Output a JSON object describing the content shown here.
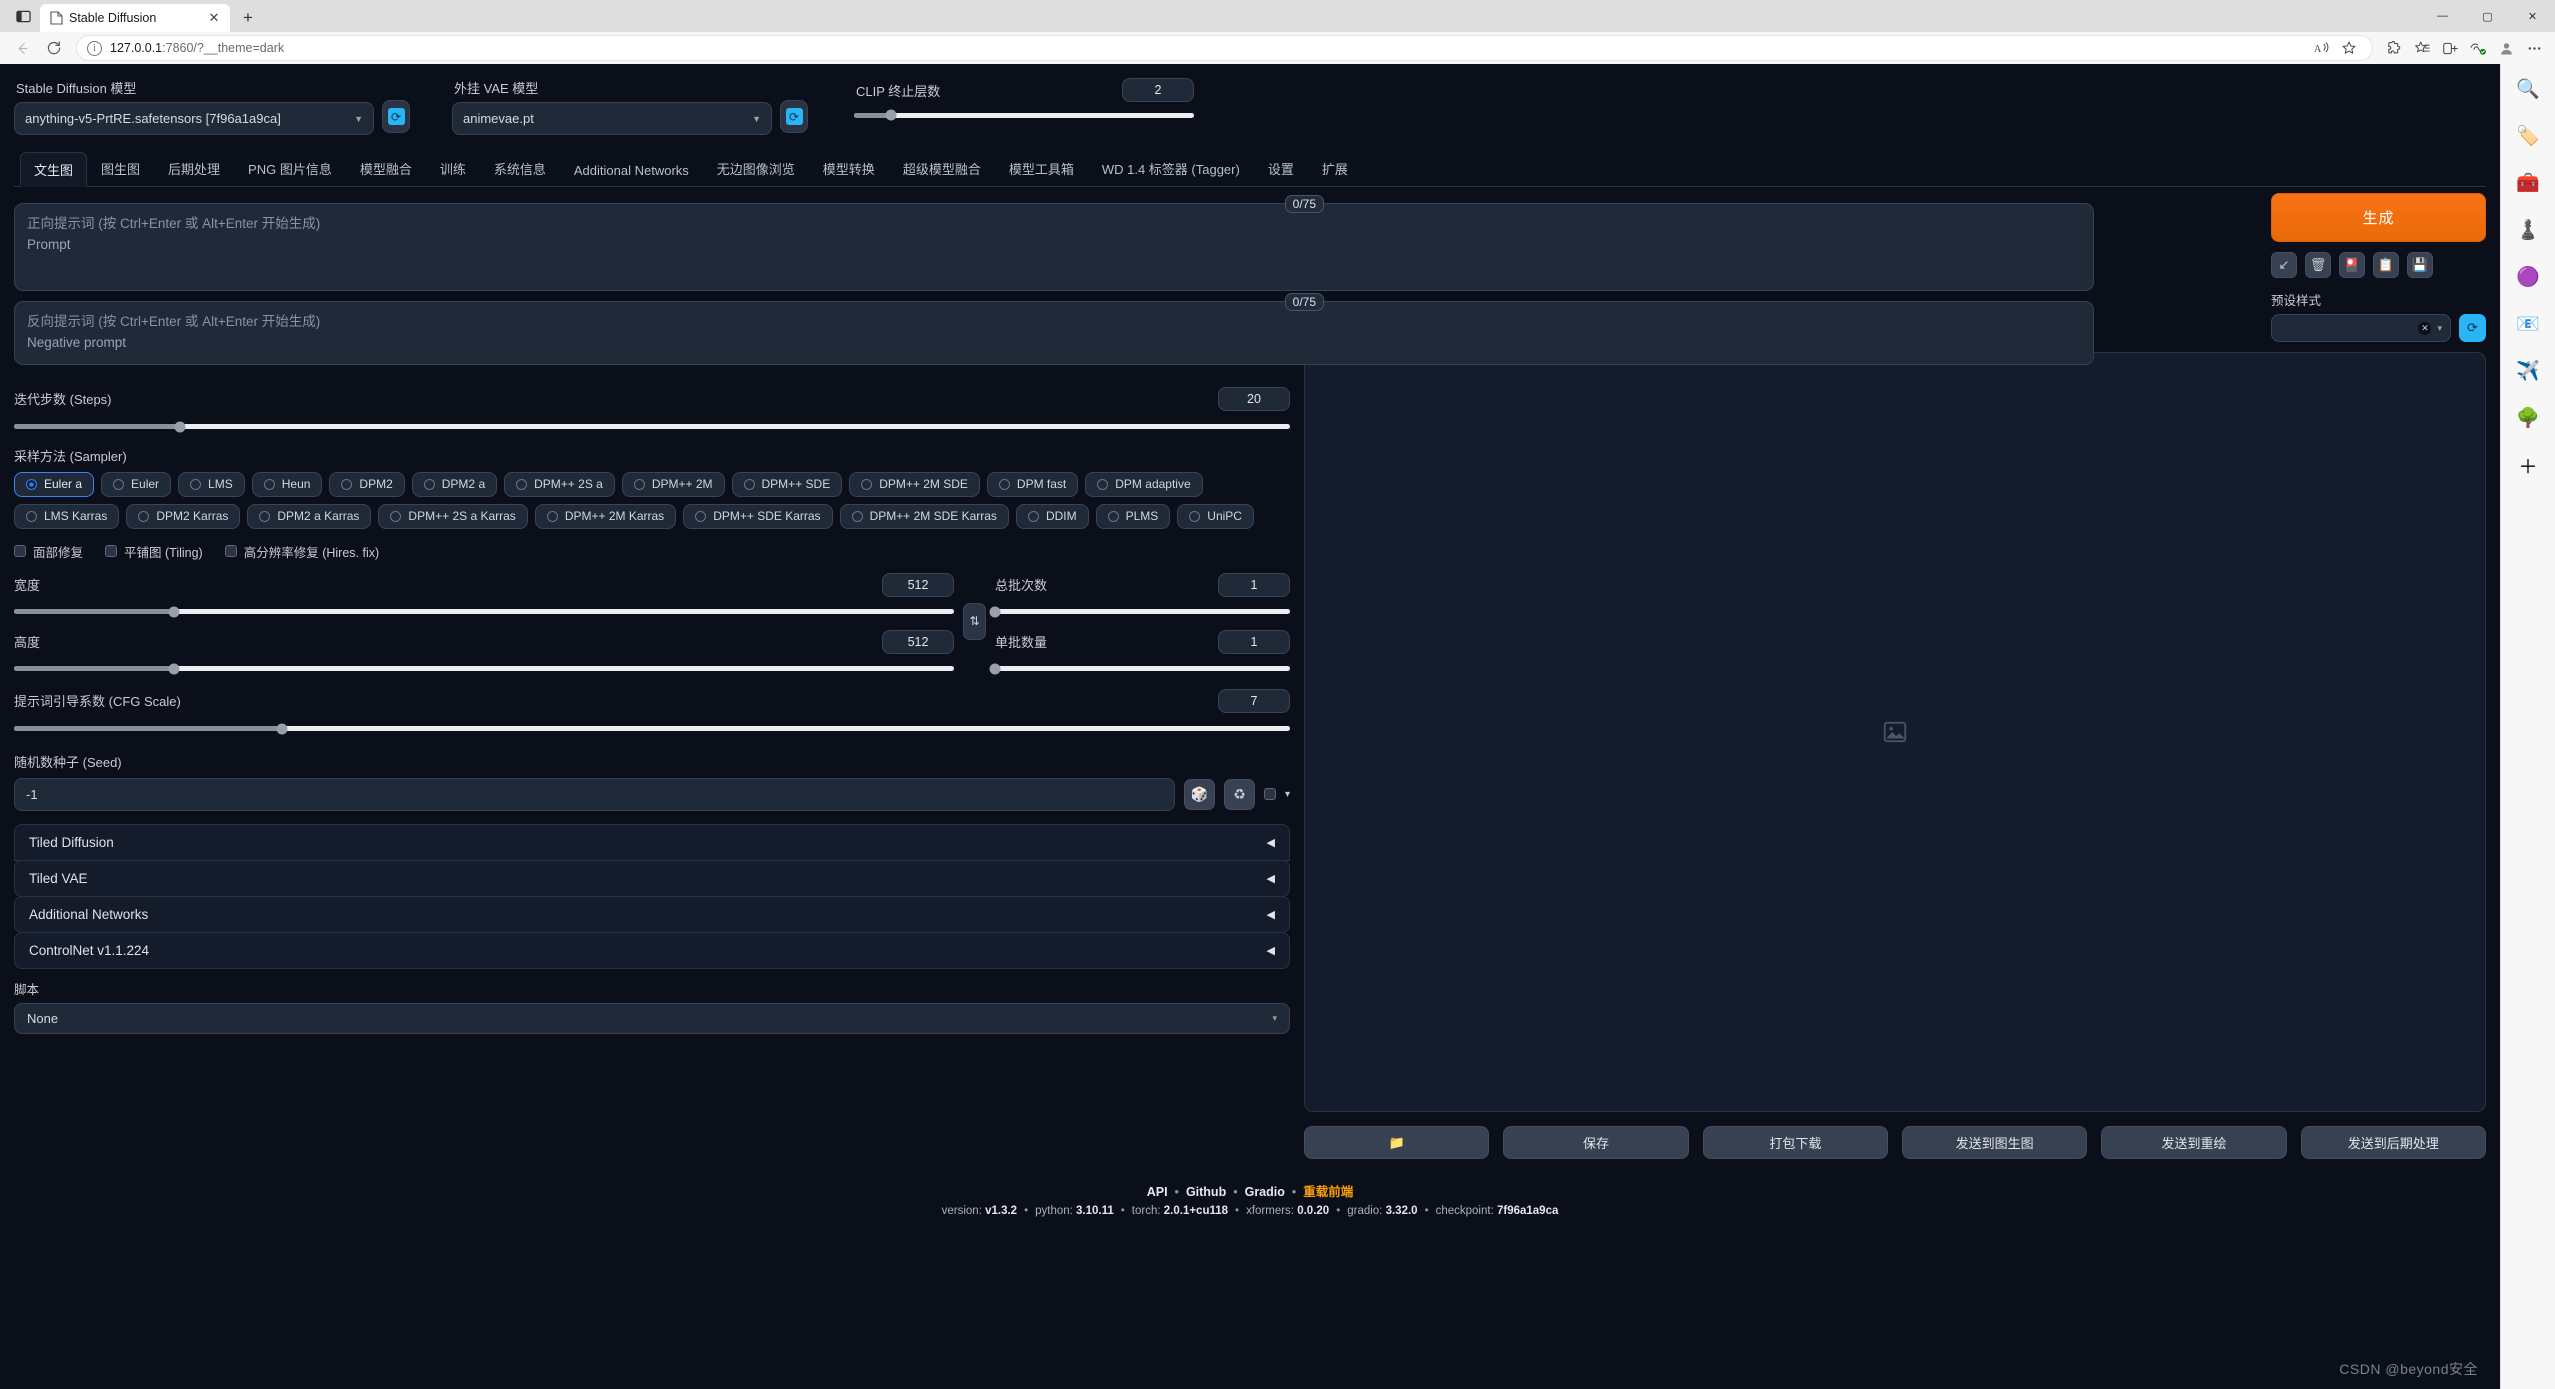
{
  "browser": {
    "tab_title": "Stable Diffusion",
    "url_main": "127.0.0.1",
    "url_rest": ":7860/?__theme=dark",
    "new_tab_label": "+",
    "close_label": "✕",
    "minimize_label": "—",
    "maximize_label": "▢",
    "window_close_label": "✕",
    "sidebar_icons": [
      "search-icon",
      "tag-icon",
      "toolbox-icon",
      "games-icon",
      "office-icon",
      "outlook-icon",
      "send-icon",
      "tree-icon",
      "add-icon"
    ],
    "sidebar_glyphs": [
      "🔍",
      "🏷️",
      "🧰",
      "♟️",
      "🟣",
      "📧",
      "✈️",
      "🌳",
      "＋"
    ],
    "toolbar_glyphs": [
      "A",
      "☆",
      "⬡",
      "⭒",
      "⧉",
      "♡",
      "●",
      "⋯"
    ]
  },
  "models": {
    "sd_label": "Stable Diffusion 模型",
    "sd_value": "anything-v5-PrtRE.safetensors [7f96a1a9ca]",
    "vae_label": "外挂 VAE 模型",
    "vae_value": "animevae.pt",
    "refresh_glyph": "⟳"
  },
  "clip": {
    "label": "CLIP 终止层数",
    "value": "2",
    "fill_pct": 11,
    "knob_pct": 11
  },
  "tabs": [
    {
      "label": "文生图",
      "active": true
    },
    {
      "label": "图生图",
      "active": false
    },
    {
      "label": "后期处理",
      "active": false
    },
    {
      "label": "PNG 图片信息",
      "active": false
    },
    {
      "label": "模型融合",
      "active": false
    },
    {
      "label": "训练",
      "active": false
    },
    {
      "label": "系统信息",
      "active": false
    },
    {
      "label": "Additional Networks",
      "active": false
    },
    {
      "label": "无边图像浏览",
      "active": false
    },
    {
      "label": "模型转换",
      "active": false
    },
    {
      "label": "超级模型融合",
      "active": false
    },
    {
      "label": "模型工具箱",
      "active": false
    },
    {
      "label": "WD 1.4 标签器 (Tagger)",
      "active": false
    },
    {
      "label": "设置",
      "active": false
    },
    {
      "label": "扩展",
      "active": false
    }
  ],
  "prompt": {
    "positive_ph_line1": "正向提示词 (按 Ctrl+Enter 或 Alt+Enter 开始生成)",
    "positive_ph_line2": "Prompt",
    "negative_ph_line1": "反向提示词 (按 Ctrl+Enter 或 Alt+Enter 开始生成)",
    "negative_ph_line2": "Negative prompt",
    "positive_tokens": "0/75",
    "negative_tokens": "0/75"
  },
  "generate": {
    "button_label": "生成",
    "mini_buttons": [
      {
        "name": "arrow-restore-icon",
        "glyph": "↙"
      },
      {
        "name": "trash-icon",
        "glyph": "🗑"
      },
      {
        "name": "extra-networks-icon",
        "glyph": "🎴"
      },
      {
        "name": "apply-style-icon",
        "glyph": "📋"
      },
      {
        "name": "save-style-icon",
        "glyph": "💾"
      }
    ],
    "styles_label": "预设样式",
    "styles_value": "",
    "styles_clear_glyph": "✕",
    "styles_caret": "▾",
    "styles_refresh_glyph": "⟳"
  },
  "steps": {
    "label": "迭代步数 (Steps)",
    "value": "20",
    "fill_pct": 13,
    "knob_pct": 13
  },
  "sampler": {
    "label": "采样方法 (Sampler)",
    "options": [
      {
        "label": "Euler a",
        "selected": true
      },
      {
        "label": "Euler",
        "selected": false
      },
      {
        "label": "LMS",
        "selected": false
      },
      {
        "label": "Heun",
        "selected": false
      },
      {
        "label": "DPM2",
        "selected": false
      },
      {
        "label": "DPM2 a",
        "selected": false
      },
      {
        "label": "DPM++ 2S a",
        "selected": false
      },
      {
        "label": "DPM++ 2M",
        "selected": false
      },
      {
        "label": "DPM++ SDE",
        "selected": false
      },
      {
        "label": "DPM++ 2M SDE",
        "selected": false
      },
      {
        "label": "DPM fast",
        "selected": false
      },
      {
        "label": "DPM adaptive",
        "selected": false
      },
      {
        "label": "LMS Karras",
        "selected": false
      },
      {
        "label": "DPM2 Karras",
        "selected": false
      },
      {
        "label": "DPM2 a Karras",
        "selected": false
      },
      {
        "label": "DPM++ 2S a Karras",
        "selected": false
      },
      {
        "label": "DPM++ 2M Karras",
        "selected": false
      },
      {
        "label": "DPM++ SDE Karras",
        "selected": false
      },
      {
        "label": "DPM++ 2M SDE Karras",
        "selected": false
      },
      {
        "label": "DDIM",
        "selected": false
      },
      {
        "label": "PLMS",
        "selected": false
      },
      {
        "label": "UniPC",
        "selected": false
      }
    ]
  },
  "checkboxes": [
    {
      "label": "面部修复",
      "checked": false
    },
    {
      "label": "平铺图 (Tiling)",
      "checked": false
    },
    {
      "label": "高分辨率修复 (Hires. fix)",
      "checked": false
    }
  ],
  "dimensions": {
    "width_label": "宽度",
    "width_value": "512",
    "width_fill_pct": 17,
    "height_label": "高度",
    "height_value": "512",
    "height_fill_pct": 17,
    "swap_glyph": "⇅",
    "batch_count_label": "总批次数",
    "batch_count_value": "1",
    "batch_count_fill_pct": 0,
    "batch_size_label": "单批数量",
    "batch_size_value": "1",
    "batch_size_fill_pct": 0
  },
  "cfg": {
    "label": "提示词引导系数 (CFG Scale)",
    "value": "7",
    "fill_pct": 21
  },
  "seed": {
    "label": "随机数种子 (Seed)",
    "value": "-1",
    "dice_glyph": "🎲",
    "recycle_glyph": "♻",
    "extra_caret": "▾"
  },
  "accordions": [
    {
      "label": "Tiled Diffusion",
      "arrow": "◀"
    },
    {
      "label": "Tiled VAE",
      "arrow": "◀"
    },
    {
      "label": "Additional Networks",
      "arrow": "◀"
    },
    {
      "label": "ControlNet v1.1.224",
      "arrow": "◀"
    }
  ],
  "script": {
    "label": "脚本",
    "value": "None",
    "caret": "▾"
  },
  "result": {
    "placeholder_icon": "image-placeholder-icon",
    "buttons": [
      {
        "label": "",
        "name": "open-folder-button",
        "glyph": "📁"
      },
      {
        "label": "保存",
        "name": "save-button",
        "glyph": ""
      },
      {
        "label": "打包下载",
        "name": "zip-download-button",
        "glyph": ""
      },
      {
        "label": "发送到图生图",
        "name": "send-to-img2img-button",
        "glyph": ""
      },
      {
        "label": "发送到重绘",
        "name": "send-to-inpaint-button",
        "glyph": ""
      },
      {
        "label": "发送到后期处理",
        "name": "send-to-extras-button",
        "glyph": ""
      }
    ]
  },
  "footer": {
    "links": [
      "API",
      "Github",
      "Gradio"
    ],
    "reload_label": "重载前端",
    "separator": "•",
    "version_items": [
      {
        "key": "version:",
        "val": "v1.3.2"
      },
      {
        "key": "python:",
        "val": "3.10.11"
      },
      {
        "key": "torch:",
        "val": "2.0.1+cu118"
      },
      {
        "key": "xformers:",
        "val": "0.0.20"
      },
      {
        "key": "gradio:",
        "val": "3.32.0"
      },
      {
        "key": "checkpoint:",
        "val": "7f96a1a9ca"
      }
    ]
  },
  "watermark": "CSDN @beyond安全"
}
